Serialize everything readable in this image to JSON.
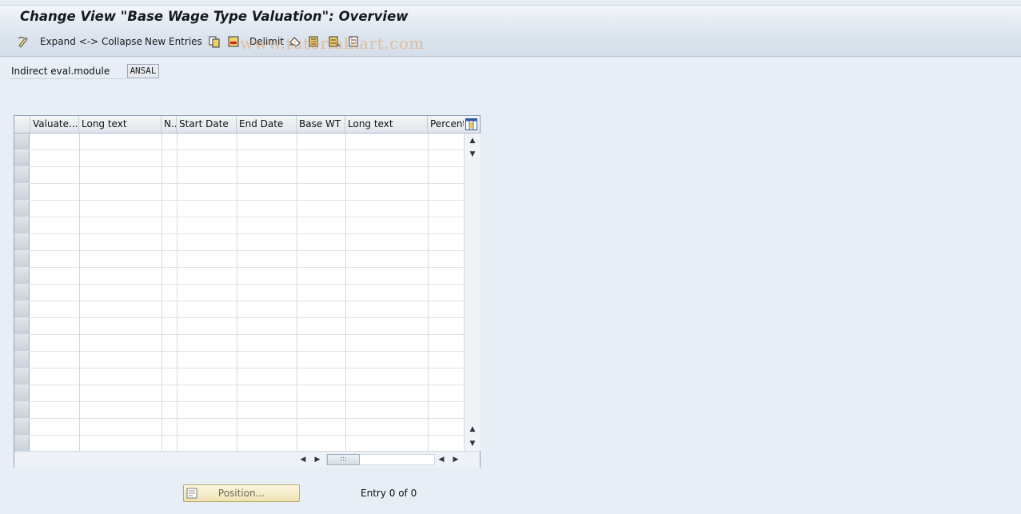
{
  "window": {
    "title": "Change View \"Base Wage Type Valuation\": Overview"
  },
  "toolbar": {
    "expand_collapse_label": "Expand <-> Collapse",
    "new_entries_label": "New Entries",
    "delimit_label": "Delimit",
    "watermark_text": "www.tutorialkart.com"
  },
  "form": {
    "indirect_eval_label": "Indirect eval.module",
    "indirect_eval_value": "ANSAL"
  },
  "table": {
    "columns": [
      "Valuate...",
      "Long text",
      "N..",
      "Start Date",
      "End Date",
      "Base WT",
      "Long text",
      "Percent"
    ],
    "row_count": 19,
    "rows": []
  },
  "footer": {
    "position_button_label": "Position...",
    "entry_text": "Entry 0 of 0"
  },
  "colors": {
    "background": "#e8eef5",
    "title_text": "#141a22",
    "button_bg": "#efe3b4"
  }
}
